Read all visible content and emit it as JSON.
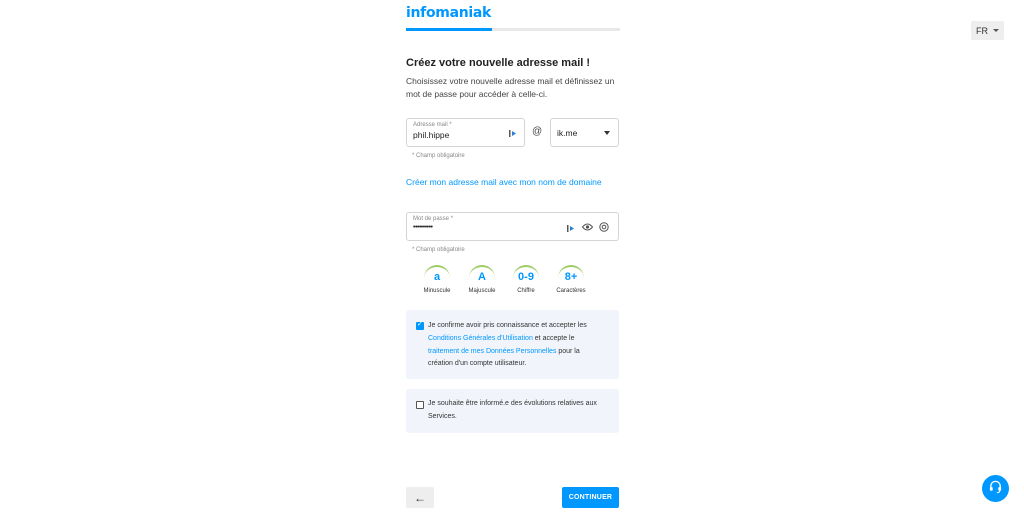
{
  "brand": {
    "name": "infomaniak",
    "color": "#0098ff"
  },
  "progress": {
    "fraction": 0.4
  },
  "language": {
    "selected": "FR"
  },
  "header": {
    "title": "Créez votre nouvelle adresse mail !",
    "subtitle": "Choisissez votre nouvelle adresse mail et définissez un mot de passe pour accéder à celle-ci."
  },
  "email": {
    "label": "Adresse mail *",
    "value": "phil.hippe",
    "at_symbol": "@",
    "domain_value": "ik.me",
    "helper": "* Champ obligatoire"
  },
  "own_domain_link": "Créer mon adresse mail avec mon nom de domaine",
  "password": {
    "label": "Mot de passe *",
    "value": "••••••••••",
    "helper": "* Champ obligatoire"
  },
  "requirements": [
    {
      "symbol": "a",
      "label": "Minuscule"
    },
    {
      "symbol": "A",
      "label": "Majuscule"
    },
    {
      "symbol": "0-9",
      "label": "Chiffre"
    },
    {
      "symbol": "8+",
      "label": "Caractères"
    }
  ],
  "terms": {
    "checked": true,
    "text_1": "Je confirme avoir pris connaissance et accepter les",
    "link_1": "Conditions Générales d'Utilisation",
    "text_2": " et accepte le",
    "link_2": "traitement de mes Données Personnelles",
    "text_3": " pour la",
    "text_4": "création d'un compte utilisateur."
  },
  "newsletter": {
    "checked": false,
    "text": "Je souhaite être informé.e des évolutions relatives aux Services."
  },
  "footer": {
    "back_icon": "arrow-left-icon",
    "back_glyph": "←",
    "continue_label": "CONTINUER",
    "help_icon": "headset-icon"
  }
}
